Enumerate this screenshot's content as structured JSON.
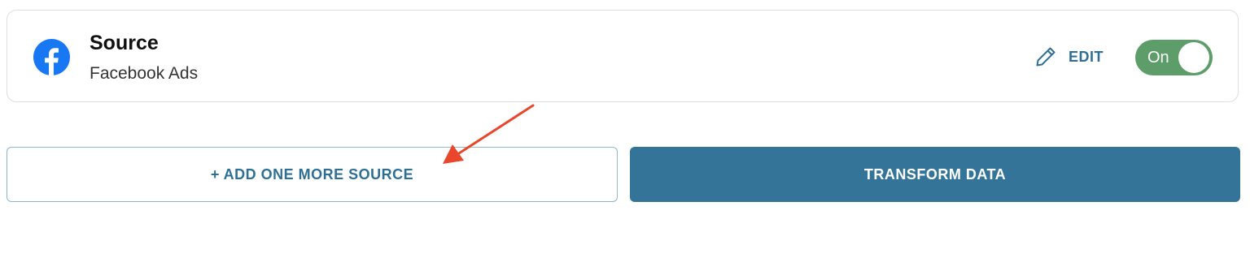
{
  "source_card": {
    "title": "Source",
    "subtitle": "Facebook Ads",
    "icon": "facebook-icon",
    "edit_label": "EDIT",
    "edit_icon": "pencil-icon",
    "toggle_label": "On",
    "toggle_on": true
  },
  "actions": {
    "add_source_label": "+ ADD ONE MORE SOURCE",
    "transform_label": "TRANSFORM DATA"
  },
  "annotation": {
    "type": "arrow",
    "points_to": "add-source-button"
  },
  "colors": {
    "facebook_blue": "#1877f2",
    "accent": "#2f6f94",
    "primary_button": "#337498",
    "toggle_on": "#5c9d6a",
    "annotation_arrow": "#e8472b"
  }
}
